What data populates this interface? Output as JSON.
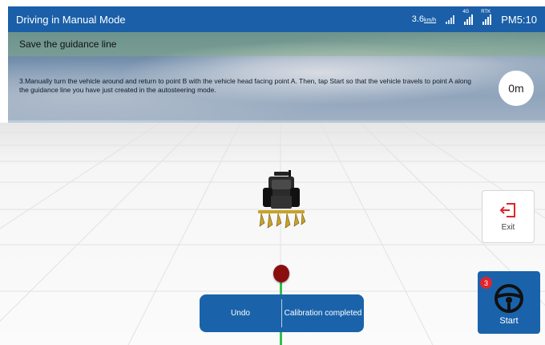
{
  "header": {
    "title": "Driving in Manual Mode",
    "speed_value": "3.6",
    "speed_unit": "km/h",
    "signal_4g_tag": "4G",
    "signal_rtk_tag": "RTK",
    "time": "PM5:10"
  },
  "guide": {
    "title": "Save the guidance line",
    "instruction": "3.Manually turn the vehicle around and return to point B with the vehicle head facing point A. Then, tap Start so that the vehicle travels to point A along the guidance line you have just created in the autosteering mode.",
    "distance": "0m"
  },
  "actions": {
    "undo_label": "Undo",
    "calibration_label": "Calibration completed"
  },
  "exit": {
    "label": "Exit"
  },
  "start": {
    "label": "Start",
    "badge": "3"
  },
  "colors": {
    "primary_blue": "#1a63ab",
    "topbar_blue": "#1a5fa8",
    "guide_line_green": "#2cc14b",
    "marker_red": "#8b0e0e",
    "badge_red": "#e0242b"
  }
}
